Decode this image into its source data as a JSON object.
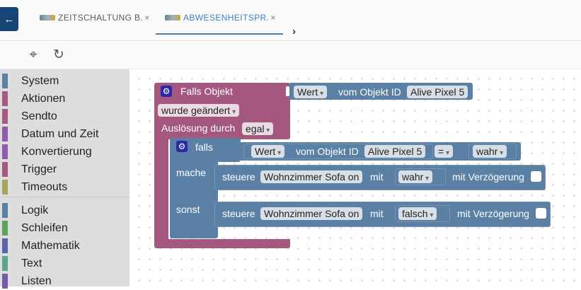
{
  "tabs": [
    {
      "label": "ZEITSCHALTUNG B.",
      "close": "×"
    },
    {
      "label": "ABWESENHEITSPR.",
      "close": "×"
    }
  ],
  "nav": {
    "back_icon": "←",
    "more_icon": "›"
  },
  "toolbar": {
    "locate_icon": "⌖",
    "refresh_icon": "↻"
  },
  "sidebar": {
    "categories": [
      {
        "label": "System",
        "color": "#5b80a5"
      },
      {
        "label": "Aktionen",
        "color": "#a55b80"
      },
      {
        "label": "Sendto",
        "color": "#a55b80"
      },
      {
        "label": "Datum und Zeit",
        "color": "#8f5bac"
      },
      {
        "label": "Konvertierung",
        "color": "#8f5bac"
      },
      {
        "label": "Trigger",
        "color": "#a55b80"
      },
      {
        "label": "Timeouts",
        "color": "#a5a55b"
      },
      {
        "label": "Logik",
        "color": "#5b80a5"
      },
      {
        "label": "Schleifen",
        "color": "#5ba55b"
      },
      {
        "label": "Mathematik",
        "color": "#5b67a5"
      },
      {
        "label": "Text",
        "color": "#5ba58c"
      },
      {
        "label": "Listen",
        "color": "#745ba5"
      }
    ]
  },
  "blocks": {
    "trigger": {
      "title": "Falls Objekt",
      "wert": "Wert",
      "vom_objekt": "vom Objekt ID",
      "object": "Alive Pixel 5",
      "condition": "wurde geändert",
      "ausloesung": "Auslösung durch",
      "ausloesung_value": "egal"
    },
    "if": {
      "falls": "falls",
      "wert": "Wert",
      "vom_objekt": "vom Objekt ID",
      "object": "Alive Pixel 5",
      "op": "=",
      "value": "wahr",
      "mache": "mache",
      "sonst": "sonst"
    },
    "then_action": {
      "steuere": "steuere",
      "target": "Wohnzimmer Sofa on",
      "mit": "mit",
      "value": "wahr",
      "delay": "mit Verzögerung"
    },
    "else_action": {
      "steuere": "steuere",
      "target": "Wohnzimmer Sofa on",
      "mit": "mit",
      "value": "falsch",
      "delay": "mit Verzögerung"
    }
  }
}
